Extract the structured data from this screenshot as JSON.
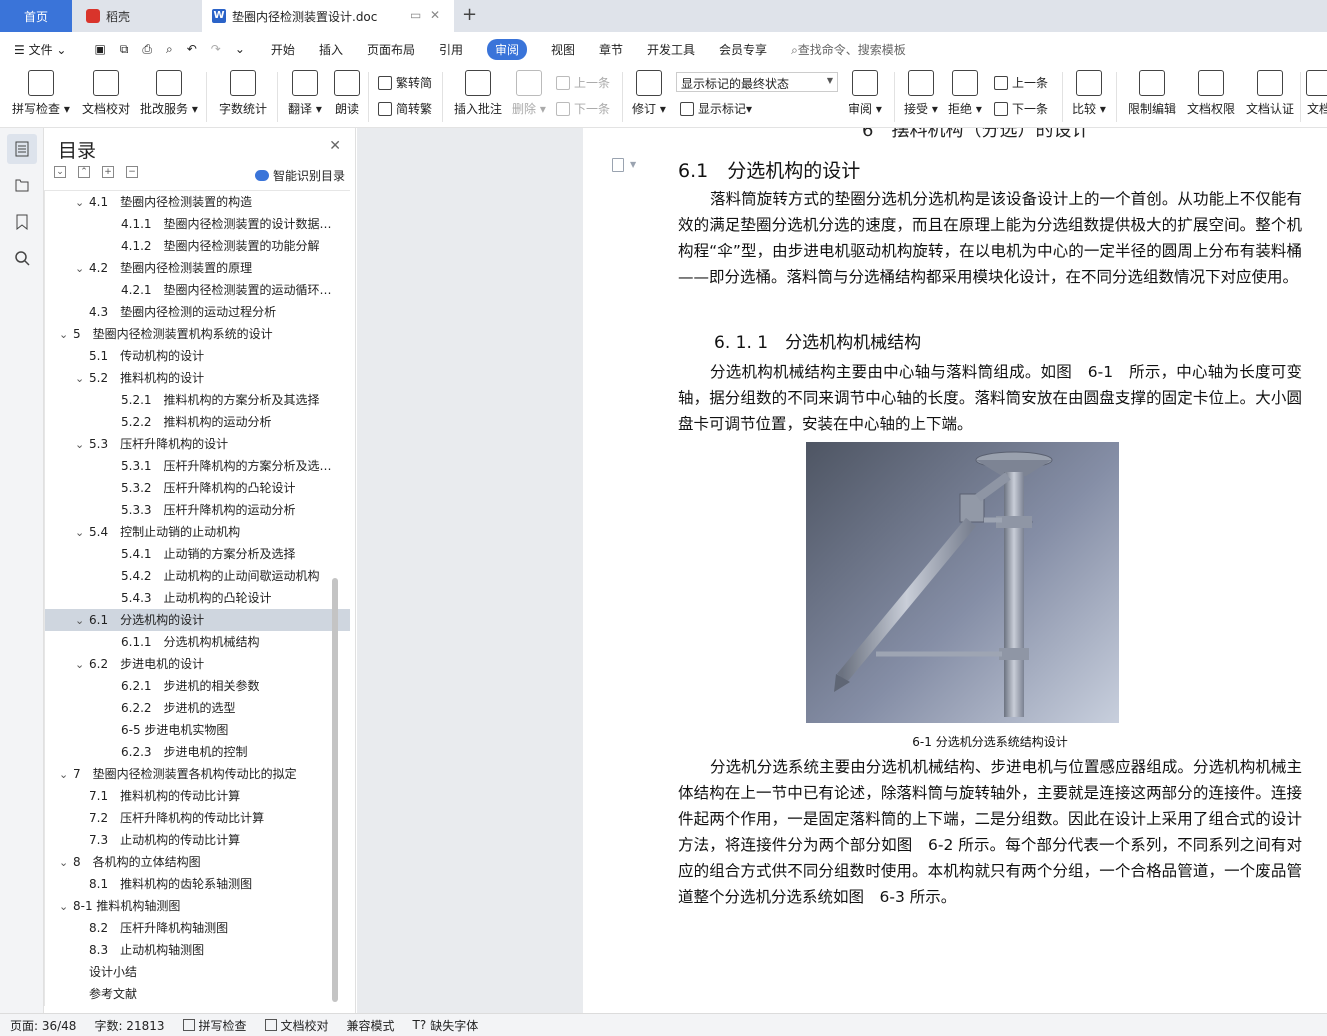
{
  "tabs": {
    "home": "首页",
    "daoke": "稻壳",
    "doc": "垫圈内径检测装置设计.doc",
    "new_tab": "+"
  },
  "menu": {
    "file": "文件",
    "items": [
      "开始",
      "插入",
      "页面布局",
      "引用",
      "审阅",
      "视图",
      "章节",
      "开发工具",
      "会员专享"
    ],
    "active": "审阅",
    "search_placeholder": "查找命令、搜索模板"
  },
  "ribbon": {
    "spell": "拼写检查",
    "proof": "文档校对",
    "annot_service": "批改服务",
    "word_count": "字数统计",
    "translate": "翻译",
    "read": "朗读",
    "trad": "繁转简",
    "simp": "简转繁",
    "insert_comment": "插入批注",
    "delete": "删除",
    "prev_comment": "上一条",
    "next_comment": "下一条",
    "revise": "修订",
    "markup_state": "显示标记的最终状态",
    "show_markup": "显示标记",
    "review": "审阅",
    "accept": "接受",
    "reject": "拒绝",
    "prev_change": "上一条",
    "next_change": "下一条",
    "compare": "比较",
    "restrict": "限制编辑",
    "permission": "文档权限",
    "certify": "文档认证",
    "more": "文档"
  },
  "toc": {
    "title": "目录",
    "smart": "智能识别目录",
    "items": [
      {
        "text": "4.1　垫圈内径检测装置的构造",
        "level": 1,
        "chev": "v"
      },
      {
        "text": "4.1.1　垫圈内径检测装置的设计数据…",
        "level": 2,
        "chev": ""
      },
      {
        "text": "4.1.2　垫圈内径检测装置的功能分解",
        "level": 2,
        "chev": ""
      },
      {
        "text": "4.2　垫圈内径检测装置的原理",
        "level": 1,
        "chev": "v"
      },
      {
        "text": "4.2.1　垫圈内径检测装置的运动循环…",
        "level": 2,
        "chev": ""
      },
      {
        "text": "4.3　垫圈内径检测的运动过程分析",
        "level": 1,
        "chev": ""
      },
      {
        "text": "5　垫圈内径检测装置机构系统的设计",
        "level": 0,
        "chev": "v"
      },
      {
        "text": "5.1　传动机构的设计",
        "level": 1,
        "chev": ""
      },
      {
        "text": "5.2　推料机构的设计",
        "level": 1,
        "chev": "v"
      },
      {
        "text": "5.2.1　推料机构的方案分析及其选择",
        "level": 2,
        "chev": ""
      },
      {
        "text": "5.2.2　推料机构的运动分析",
        "level": 2,
        "chev": ""
      },
      {
        "text": "5.3　压杆升降机构的设计",
        "level": 1,
        "chev": "v"
      },
      {
        "text": "5.3.1　压杆升降机构的方案分析及选…",
        "level": 2,
        "chev": ""
      },
      {
        "text": "5.3.2　压杆升降机构的凸轮设计",
        "level": 2,
        "chev": ""
      },
      {
        "text": "5.3.3　压杆升降机构的运动分析",
        "level": 2,
        "chev": ""
      },
      {
        "text": "5.4　控制止动销的止动机构",
        "level": 1,
        "chev": "v"
      },
      {
        "text": "5.4.1　止动销的方案分析及选择",
        "level": 2,
        "chev": ""
      },
      {
        "text": "5.4.2　止动机构的止动间歇运动机构",
        "level": 2,
        "chev": ""
      },
      {
        "text": "5.4.3　止动机构的凸轮设计",
        "level": 2,
        "chev": ""
      },
      {
        "text": "6.1　分选机构的设计",
        "level": 1,
        "chev": "v",
        "selected": true
      },
      {
        "text": "6.1.1　分选机构机械结构",
        "level": 2,
        "chev": ""
      },
      {
        "text": "6.2　步进电机的设计",
        "level": 1,
        "chev": "v"
      },
      {
        "text": "6.2.1　步进机的相关参数",
        "level": 2,
        "chev": ""
      },
      {
        "text": "6.2.2　步进机的选型",
        "level": 2,
        "chev": ""
      },
      {
        "text": "6-5 步进电机实物图",
        "level": 2,
        "chev": ""
      },
      {
        "text": "6.2.3　步进电机的控制",
        "level": 2,
        "chev": ""
      },
      {
        "text": "7　垫圈内径检测装置各机构传动比的拟定",
        "level": 0,
        "chev": "v"
      },
      {
        "text": "7.1　推料机构的传动比计算",
        "level": 1,
        "chev": ""
      },
      {
        "text": "7.2　压杆升降机构的传动比计算",
        "level": 1,
        "chev": ""
      },
      {
        "text": "7.3　止动机构的传动比计算",
        "level": 1,
        "chev": ""
      },
      {
        "text": "8　各机构的立体结构图",
        "level": 0,
        "chev": "v"
      },
      {
        "text": "8.1　推料机构的齿轮系轴测图",
        "level": 1,
        "chev": ""
      },
      {
        "text": "8-1 推料机构轴测图",
        "level": 0,
        "chev": "v"
      },
      {
        "text": "8.2　压杆升降机构轴测图",
        "level": 1,
        "chev": ""
      },
      {
        "text": "8.3　止动机构轴测图",
        "level": 1,
        "chev": ""
      },
      {
        "text": "设计小结",
        "level": -1,
        "chev": ""
      },
      {
        "text": "参考文献",
        "level": -1,
        "chev": ""
      }
    ]
  },
  "doc": {
    "cutoff": "6　摆料机构（分选）的设计",
    "h2": "6.1　分选机构的设计",
    "p1": "落料筒旋转方式的垫圈分选机分选机构是该设备设计上的一个首创。从功能上不仅能有效的满足垫圈分选机分选的速度，而且在原理上能为分选组数提供极大的扩展空间。整个机构程“伞”型，由步进电机驱动机构旋转，在以电机为中心的一定半径的圆周上分布有装料桶——即分选桶。落料筒与分选桶结构都采用模块化设计，在不同分选组数情况下对应使用。",
    "h3": "6. 1. 1　分选机构机械结构",
    "p2": "分选机构机械结构主要由中心轴与落料筒组成。如图　6-1　所示，中心轴为长度可变轴，据分组数的不同来调节中心轴的长度。落料筒安放在由圆盘支撑的固定卡位上。大小圆盘卡可调节位置，安装在中心轴的上下端。",
    "caption": "6-1 分选机分选系统结构设计",
    "p3": "分选机分选系统主要由分选机机械结构、步进电机与位置感应器组成。分选机构机械主体结构在上一节中已有论述，除落料筒与旋转轴外，主要就是连接这两部分的连接件。连接件起两个作用，一是固定落料筒的上下端，二是分组数。因此在设计上采用了组合式的设计方法，将连接件分为两个部分如图　6-2 所示。每个部分代表一个系列，不同系列之间有对应的组合方式供不同分组数时使用。本机构就只有两个分组，一个合格品管道，一个废品管道整个分选机分选系统如图　6-3 所示。"
  },
  "status": {
    "page": "页面: 36/48",
    "words": "字数: 21813",
    "spell": "拼写检查",
    "proof": "文档校对",
    "compat": "兼容模式",
    "font": "缺失字体"
  },
  "colors": {
    "accent": "#3a74d9",
    "selected_toc": "#cfd6df"
  }
}
